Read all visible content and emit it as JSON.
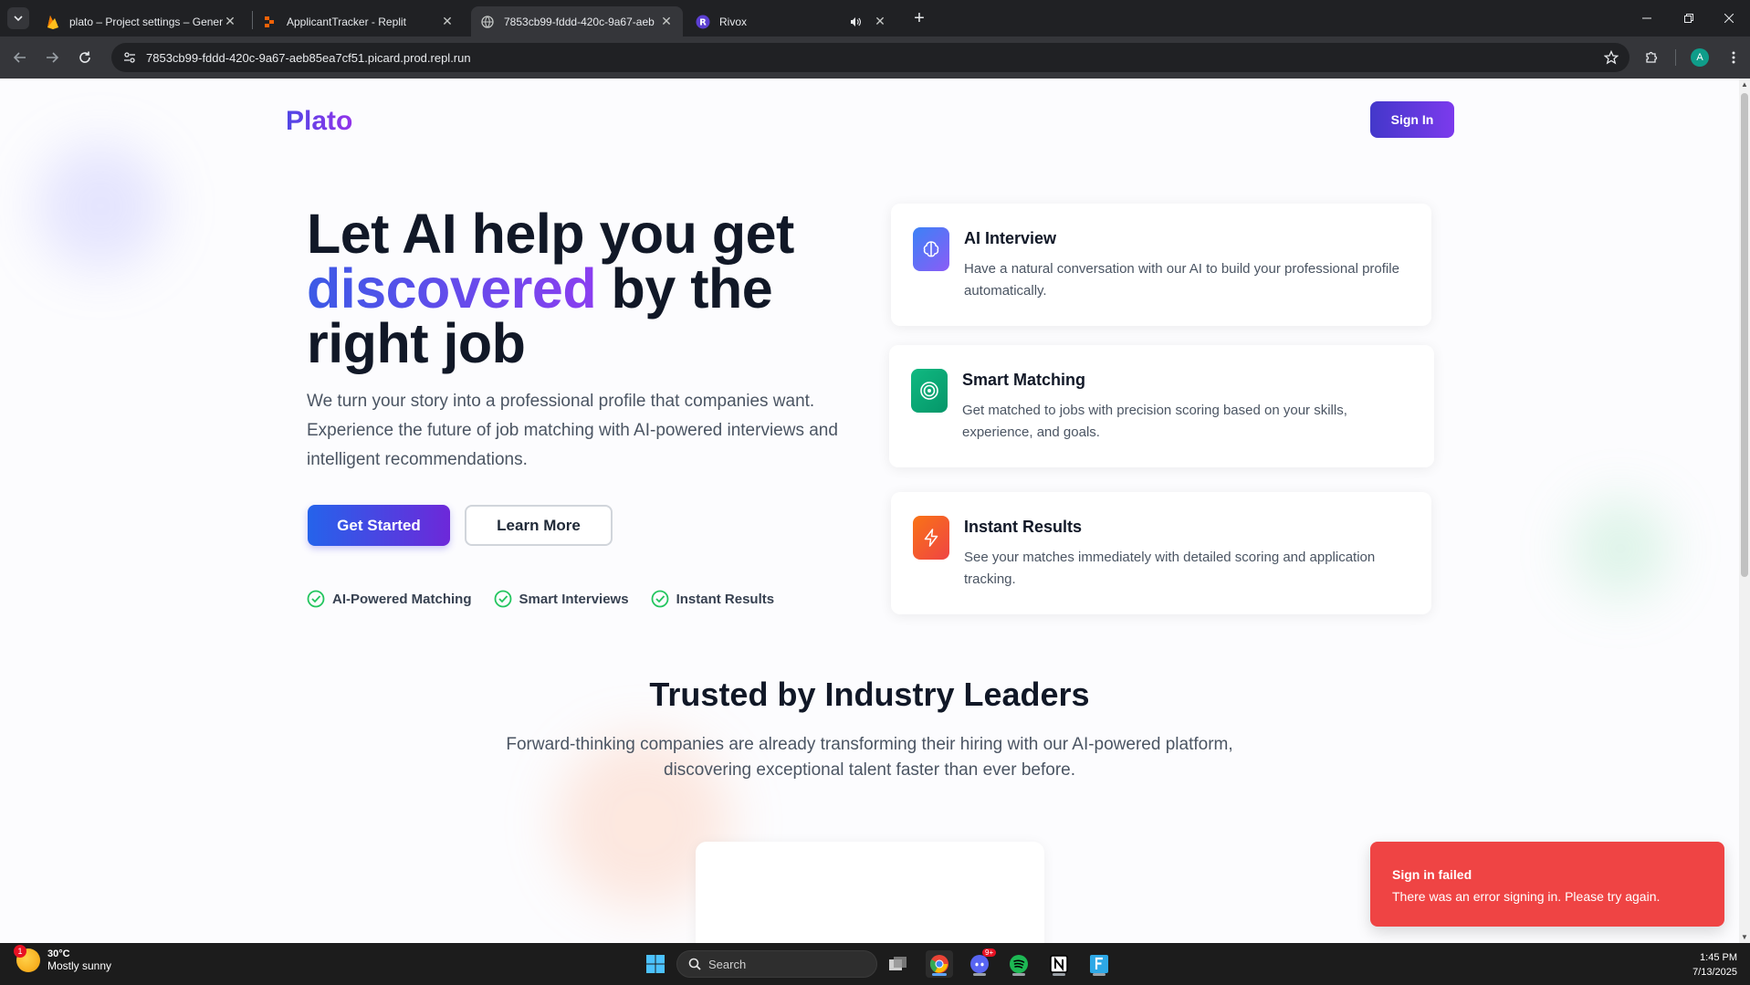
{
  "browser": {
    "tabs": [
      {
        "title": "plato – Project settings – Gener",
        "favicon": "firebase-icon",
        "active": false
      },
      {
        "title": "ApplicantTracker - Replit",
        "favicon": "replit-icon",
        "active": false
      },
      {
        "title": "7853cb99-fddd-420c-9a67-aeb",
        "favicon": "globe-icon",
        "active": true
      },
      {
        "title": "Rivox",
        "favicon": "rivox-icon",
        "active": false
      }
    ],
    "url": "7853cb99-fddd-420c-9a67-aeb85ea7cf51.picard.prod.repl.run",
    "profile_initial": "A"
  },
  "page": {
    "logo": "Plato",
    "signin_label": "Sign In",
    "hero": {
      "title_line1": "Let AI help you get",
      "title_highlight": "discovered",
      "title_after_highlight": " by the",
      "title_line3": "right job",
      "subtitle": "We turn your story into a professional profile that companies want. Experience the future of job matching with AI-powered interviews and intelligent recommendations.",
      "primary_cta": "Get Started",
      "secondary_cta": "Learn More",
      "features": [
        "AI-Powered Matching",
        "Smart Interviews",
        "Instant Results"
      ]
    },
    "cards": [
      {
        "title": "AI Interview",
        "description": "Have a natural conversation with our AI to build your professional profile automatically.",
        "icon": "brain-icon",
        "color": "#6366f1"
      },
      {
        "title": "Smart Matching",
        "description": "Get matched to jobs with precision scoring based on your skills, experience, and goals.",
        "icon": "target-icon",
        "color": "#10b981"
      },
      {
        "title": "Instant Results",
        "description": "See your matches immediately with detailed scoring and application tracking.",
        "icon": "lightning-icon",
        "color": "#f97316"
      }
    ],
    "trusted": {
      "title": "Trusted by Industry Leaders",
      "subtitle": "Forward-thinking companies are already transforming their hiring with our AI-powered platform, discovering exceptional talent faster than ever before."
    },
    "toast": {
      "title": "Sign in failed",
      "description": "There was an error signing in. Please try again.",
      "color": "#ef4444"
    }
  },
  "taskbar": {
    "weather_temp": "30°C",
    "weather_desc": "Mostly sunny",
    "weather_badge": "1",
    "search_placeholder": "Search",
    "discord_badge": "9+",
    "time": "1:45 PM",
    "date": "7/13/2025"
  }
}
